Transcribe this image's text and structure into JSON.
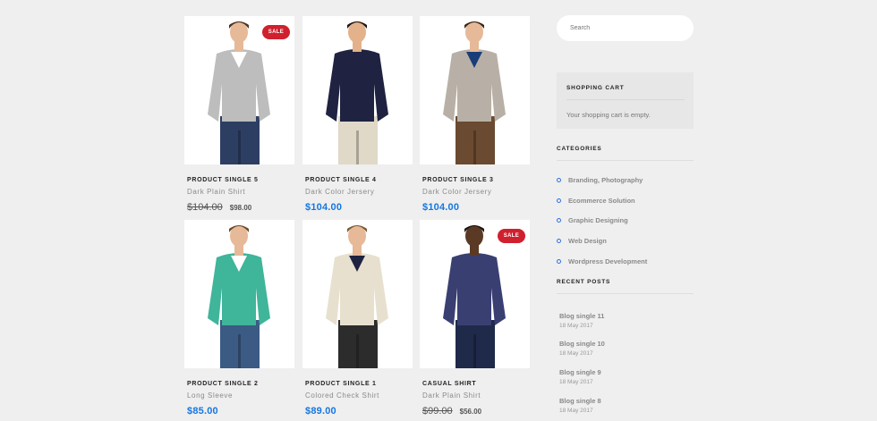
{
  "products": [
    {
      "title": "PRODUCT SINGLE 5",
      "subtitle": "Dark Plain Shirt",
      "sale": true,
      "badge": "SALE",
      "old_price": "$104.00",
      "price": "$98.00",
      "colors": {
        "top": "#bdbdbd",
        "inner": "#ffffff",
        "pants": "#2d3e63",
        "skin": "#e6b998",
        "hair": "#4a3020"
      }
    },
    {
      "title": "PRODUCT SINGLE 4",
      "subtitle": "Dark Color Jersery",
      "sale": false,
      "price": "$104.00",
      "colors": {
        "top": "#1f2240",
        "inner": "#1f2240",
        "pants": "#e0d9c8",
        "skin": "#e3b28a",
        "hair": "#1f1410"
      }
    },
    {
      "title": "PRODUCT SINGLE 3",
      "subtitle": "Dark Color Jersery",
      "sale": false,
      "price": "$104.00",
      "colors": {
        "top": "#b8b0a6",
        "inner": "#1a3d78",
        "pants": "#6a4a30",
        "skin": "#e6b998",
        "hair": "#3a2616"
      }
    },
    {
      "title": "PRODUCT SINGLE 2",
      "subtitle": "Long Sleeve",
      "sale": false,
      "price": "$85.00",
      "colors": {
        "top": "#3fb59a",
        "inner": "#ffffff",
        "pants": "#3b5a84",
        "skin": "#e6b998",
        "hair": "#6b4a2a"
      }
    },
    {
      "title": "PRODUCT SINGLE 1",
      "subtitle": "Colored Check Shirt",
      "sale": false,
      "price": "$89.00",
      "colors": {
        "top": "#e8e0cf",
        "inner": "#1d2340",
        "pants": "#2c2c2c",
        "skin": "#e6b998",
        "hair": "#7a5a34"
      }
    },
    {
      "title": "CASUAL SHIRT",
      "subtitle": "Dark Plain Shirt",
      "sale": true,
      "badge": "SALE",
      "old_price": "$99.00",
      "price": "$56.00",
      "colors": {
        "top": "#3a3f72",
        "inner": "#3a3f72",
        "pants": "#1f2a4a",
        "skin": "#5a3a24",
        "hair": "#1a120c"
      }
    }
  ],
  "sidebar": {
    "search_placeholder": "Search",
    "cart": {
      "title": "SHOPPING CART",
      "text": "Your shopping cart is empty."
    },
    "categories": {
      "title": "CATEGORIES",
      "items": [
        "Branding, Photography",
        "Ecommerce Solution",
        "Graphic Designing",
        "Web Design",
        "Wordpress Development"
      ]
    },
    "recent_posts": {
      "title": "RECENT POSTS",
      "items": [
        {
          "title": "Blog single 11",
          "date": "18 May 2017"
        },
        {
          "title": "Blog single 10",
          "date": "18 May 2017"
        },
        {
          "title": "Blog single 9",
          "date": "18 May 2017"
        },
        {
          "title": "Blog single 8",
          "date": "18 May 2017"
        }
      ]
    }
  },
  "colors": {
    "price_blue": "#1677e0",
    "sale_red": "#d0202e",
    "bullet_blue": "#2f6fe0"
  }
}
